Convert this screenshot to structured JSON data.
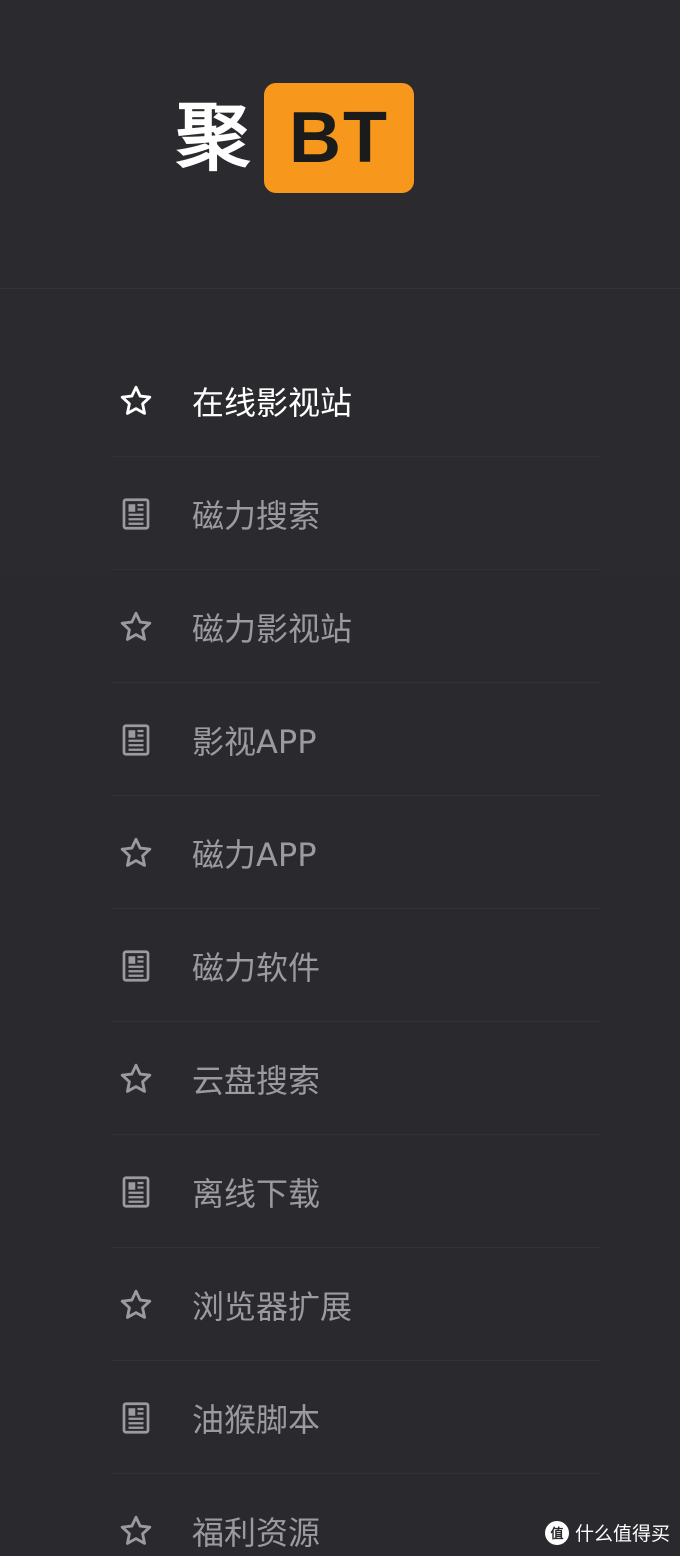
{
  "logo": {
    "char": "聚",
    "badge": "BT",
    "badge_color": "#f7981d"
  },
  "nav": {
    "items": [
      {
        "label": "在线影视站",
        "icon": "star-icon",
        "active": true
      },
      {
        "label": "磁力搜索",
        "icon": "newspaper-icon",
        "active": false
      },
      {
        "label": "磁力影视站",
        "icon": "star-icon",
        "active": false
      },
      {
        "label": "影视APP",
        "icon": "newspaper-icon",
        "active": false
      },
      {
        "label": "磁力APP",
        "icon": "star-icon",
        "active": false
      },
      {
        "label": "磁力软件",
        "icon": "newspaper-icon",
        "active": false
      },
      {
        "label": "云盘搜索",
        "icon": "star-icon",
        "active": false
      },
      {
        "label": "离线下载",
        "icon": "newspaper-icon",
        "active": false
      },
      {
        "label": "浏览器扩展",
        "icon": "star-icon",
        "active": false
      },
      {
        "label": "油猴脚本",
        "icon": "newspaper-icon",
        "active": false
      },
      {
        "label": "福利资源",
        "icon": "star-icon",
        "active": false
      }
    ]
  },
  "watermark": {
    "icon_text": "值",
    "text": "什么值得买"
  },
  "colors": {
    "background": "#2a2a2e",
    "active_text": "#ffffff",
    "inactive_text": "#9a9aa0",
    "accent": "#f7981d"
  }
}
